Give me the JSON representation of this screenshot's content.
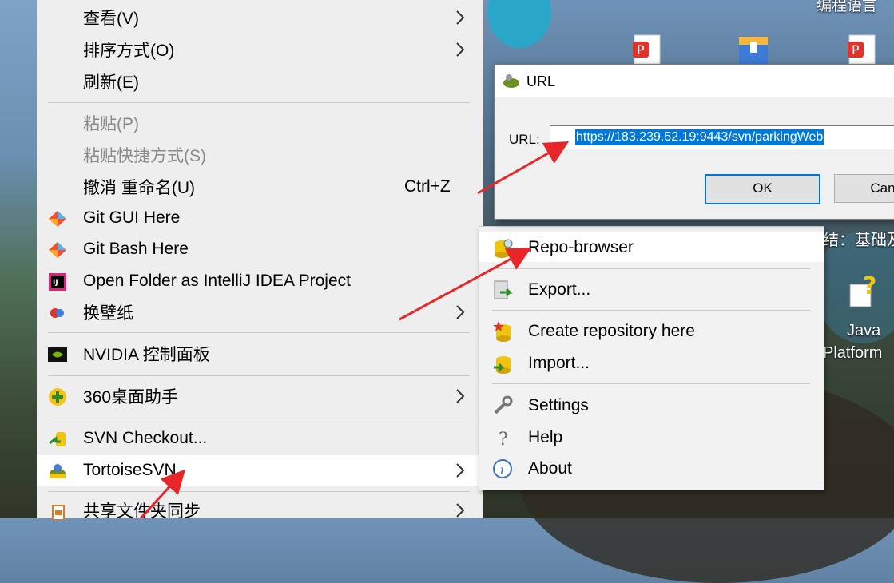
{
  "context_menu": {
    "items": [
      {
        "label": "查看(V)",
        "submenu": true
      },
      {
        "label": "排序方式(O)",
        "submenu": true
      },
      {
        "label": "刷新(E)"
      },
      {
        "label": "粘贴(P)",
        "disabled": true
      },
      {
        "label": "粘贴快捷方式(S)",
        "disabled": true
      },
      {
        "label": "撤消 重命名(U)",
        "shortcut": "Ctrl+Z"
      },
      {
        "label": "Git GUI Here",
        "icon": "git-icon"
      },
      {
        "label": "Git Bash Here",
        "icon": "git-icon"
      },
      {
        "label": "Open Folder as IntelliJ IDEA Project",
        "icon": "intellij-icon"
      },
      {
        "label": "换壁纸",
        "icon": "wallpaper-icon",
        "submenu": true
      },
      {
        "label": "NVIDIA 控制面板",
        "icon": "nvidia-icon"
      },
      {
        "label": "360桌面助手",
        "icon": "360-icon",
        "submenu": true
      },
      {
        "label": "SVN Checkout...",
        "icon": "svn-checkout-icon"
      },
      {
        "label": "TortoiseSVN",
        "icon": "tortoisesvn-icon",
        "submenu": true,
        "highlighted": true
      },
      {
        "label": "共享文件夹同步",
        "icon": "sync-icon",
        "submenu": true
      }
    ]
  },
  "tortoise_submenu": {
    "items": [
      {
        "label": "Repo-browser",
        "icon": "repo-browser-icon",
        "highlighted": true
      },
      {
        "label": "Export...",
        "icon": "export-icon"
      },
      {
        "label": "Create repository here",
        "icon": "create-repo-icon"
      },
      {
        "label": "Import...",
        "icon": "import-icon"
      },
      {
        "label": "Settings",
        "icon": "wrench-icon"
      },
      {
        "label": "Help",
        "icon": "help-icon"
      },
      {
        "label": "About",
        "icon": "info-icon"
      }
    ]
  },
  "url_dialog": {
    "title": "URL",
    "url_label": "URL:",
    "url_value": "https://183.239.52.19:9443/svn/parkingWeb",
    "ok_label": "OK",
    "cancel_label": "Can"
  },
  "desktop": {
    "top_label": "编程语言",
    "side_text_1": "结：基础及",
    "icon_label_1": "Java",
    "icon_label_2": "Platform"
  },
  "colors": {
    "accent": "#0078d7",
    "annotation_arrow": "#e8262a",
    "menu_bg": "#eeeeee"
  }
}
